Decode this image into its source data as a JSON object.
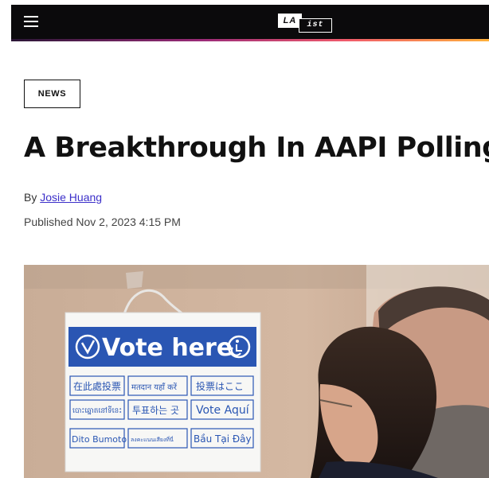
{
  "header": {
    "logo_la": "LA",
    "logo_ist": "ist",
    "brand_color": "#0b0a0c",
    "menu_icon": "hamburger-menu-icon"
  },
  "article": {
    "category": "NEWS",
    "headline": "A Breakthrough In AAPI Polling",
    "byline_prefix": "By",
    "author": "Josie Huang",
    "published": "Published Nov 2, 2023 4:15 PM"
  },
  "photo": {
    "sign_title": "Vote here",
    "languages": [
      [
        "在此處投票",
        "मतदान यहाँ करें",
        "投票はここ"
      ],
      [
        "បោះឆ្នោតនៅទីនេះ",
        "투표하는 곳",
        "Vote Aquí"
      ],
      [
        "Dito Bumoto",
        "ลงคะแนนเสียงที่นี่",
        "Bầu Tại Đây"
      ]
    ]
  }
}
